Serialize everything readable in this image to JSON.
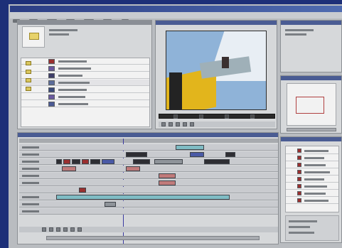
{
  "app": {
    "accent": "#1d2f78",
    "window_bg": "#b9bcc0",
    "panel_bg": "#d6d8da"
  },
  "project_panel": {
    "folder_icon": "folder-icon",
    "clips": [
      {
        "color": "#9a2f2f"
      },
      {
        "color": "#6a58a0"
      },
      {
        "color": "#3e3e6a"
      },
      {
        "color": "#5b6c9a"
      },
      {
        "color": "#3a4a7a"
      },
      {
        "color": "#6b5aa0"
      },
      {
        "color": "#4b5a95"
      }
    ]
  },
  "monitor": {
    "video_colors": {
      "sky": "#8fb3d8",
      "cloud": "#e8eef4",
      "yellow": "#e2b51c",
      "dark": "#232323"
    }
  },
  "timeline": {
    "playhead_color": "#3a3aa0",
    "tracks": 10
  },
  "effects_panel": {
    "items": 8
  }
}
